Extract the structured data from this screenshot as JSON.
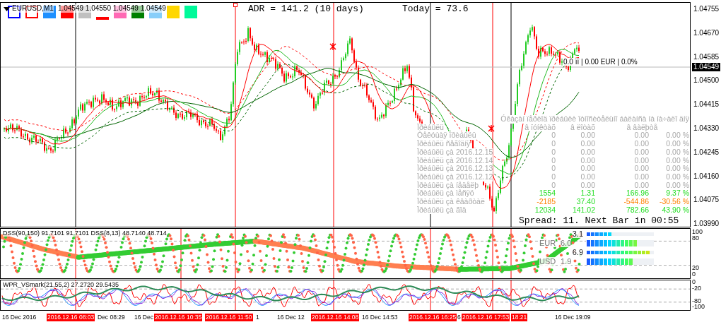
{
  "chart": {
    "symbol": "EURUSD,M1",
    "quote": "1.04549 1.04550 1.04549 1.04549",
    "swatches": [
      {
        "kind": "outline",
        "color": "#0000ff"
      },
      {
        "kind": "outline",
        "color": "#ff0000"
      },
      {
        "kind": "fill",
        "color": "#1e90ff"
      },
      {
        "kind": "fill",
        "color": "#ff0000"
      },
      {
        "kind": "fill",
        "color": "#c0c0c0"
      },
      {
        "kind": "underline",
        "color": "#ff0000"
      },
      {
        "kind": "fill",
        "color": "#ff69b4"
      },
      {
        "kind": "fill",
        "color": "#008000"
      },
      {
        "kind": "fill",
        "color": "#87cefa"
      },
      {
        "kind": "fill",
        "color": "#ffd700"
      },
      {
        "kind": "fill",
        "color": "#00fa9a"
      }
    ],
    "adr": "ADR = 141.2  (10 days)",
    "today": "Today = 73.6",
    "position_info": "0.0 ïï | 0.00 EUR | 0.0%",
    "spread": "Spread: 11. Next Bar in 00:55",
    "price_axis": [
      "1.04755",
      "1.04670",
      "1.04585",
      "1.04500",
      "1.04415",
      "1.04330",
      "1.04245",
      "1.04160",
      "1.04075",
      "1.03990"
    ],
    "current_price": "1.04549"
  },
  "stats": {
    "title": "Óêàçàí ïåðèîä ïðèáûëè îòíîñèòåëüíî áàëàíñà íà íà÷àëî äíÿ",
    "columns": [
      "Ïðèáûëü",
      "â ïóíêòàõ",
      "â ëîòàõ",
      "â âàëþòå"
    ],
    "rows": [
      {
        "label": "Òåêóùàÿ ïðèáûëü",
        "values": [
          {
            "text": "0",
            "kind": "neutral"
          },
          {
            "text": "0.00",
            "kind": "neutral"
          },
          {
            "text": "0.00",
            "kind": "neutral"
          },
          {
            "text": "0.00 %",
            "kind": "neutral"
          }
        ]
      },
      {
        "label": "Ïðèáûëü ñåãîäíÿ",
        "values": [
          {
            "text": "0",
            "kind": "neutral"
          },
          {
            "text": "0.00",
            "kind": "neutral"
          },
          {
            "text": "0.00",
            "kind": "neutral"
          },
          {
            "text": "0.00 %",
            "kind": "neutral"
          }
        ]
      },
      {
        "label": "Ïðèáûëü çà 2016.12.15",
        "values": [
          {
            "text": "0",
            "kind": "neutral"
          },
          {
            "text": "0.00",
            "kind": "neutral"
          },
          {
            "text": "0.00",
            "kind": "neutral"
          },
          {
            "text": "0.00 %",
            "kind": "neutral"
          }
        ]
      },
      {
        "label": "Ïðèáûëü çà 2016.12.14",
        "values": [
          {
            "text": "0",
            "kind": "neutral"
          },
          {
            "text": "0.00",
            "kind": "neutral"
          },
          {
            "text": "0.00",
            "kind": "neutral"
          },
          {
            "text": "0.00 %",
            "kind": "neutral"
          }
        ]
      },
      {
        "label": "Ïðèáûëü çà 2016.12.13",
        "values": [
          {
            "text": "0",
            "kind": "neutral"
          },
          {
            "text": "0.00",
            "kind": "neutral"
          },
          {
            "text": "0.00",
            "kind": "neutral"
          },
          {
            "text": "0.00 %",
            "kind": "neutral"
          }
        ]
      },
      {
        "label": "Ïðèáûëü çà 2016.12.12",
        "values": [
          {
            "text": "0",
            "kind": "neutral"
          },
          {
            "text": "0.00",
            "kind": "neutral"
          },
          {
            "text": "0.00",
            "kind": "neutral"
          },
          {
            "text": "0.00 %",
            "kind": "neutral"
          }
        ]
      },
      {
        "label": "Ïðèáûëü çà íåäåëþ",
        "values": [
          {
            "text": "0",
            "kind": "neutral"
          },
          {
            "text": "0.00",
            "kind": "neutral"
          },
          {
            "text": "0.00",
            "kind": "neutral"
          },
          {
            "text": "0.00 %",
            "kind": "neutral"
          }
        ]
      },
      {
        "label": "Ïðèáûëü çà ìåñÿö",
        "values": [
          {
            "text": "1554",
            "kind": "profit"
          },
          {
            "text": "1.31",
            "kind": "profit"
          },
          {
            "text": "166.96",
            "kind": "profit"
          },
          {
            "text": "9.37 %",
            "kind": "profit"
          }
        ]
      },
      {
        "label": "Ïðèáûëü çà êâàðòàë",
        "values": [
          {
            "text": "-2185",
            "kind": "loss"
          },
          {
            "text": "37.40",
            "kind": "profit"
          },
          {
            "text": "-544.86",
            "kind": "loss"
          },
          {
            "text": "-30.56 %",
            "kind": "loss"
          }
        ]
      },
      {
        "label": "Ïðèáûëü çà ãîä",
        "values": [
          {
            "text": "12034",
            "kind": "profit"
          },
          {
            "text": "141.02",
            "kind": "profit"
          },
          {
            "text": "782.66",
            "kind": "profit"
          },
          {
            "text": "43.90 %",
            "kind": "profit"
          }
        ]
      }
    ]
  },
  "dss_panel": {
    "title": "DSS(90,150) 91.7101 91.7101 DSS(8,13) 48.7140 48.714",
    "scale": [
      "100",
      "80",
      "20",
      "0"
    ],
    "currencies": [
      {
        "score": "3.1",
        "name": "EUR",
        "value": "6.0",
        "short_bar": {
          "level": 0.38
        },
        "long_bar": {
          "level": 0.75
        }
      },
      {
        "score": "6.9",
        "name": "USD",
        "value": "1.9",
        "short_bar": {
          "level": 0.94
        },
        "long_bar": {
          "level": 0.69
        }
      }
    ]
  },
  "wpr_panel": {
    "title": "WPR_VSmark(21,55,2) 27.2720 29.5435",
    "scale": [
      "0",
      "-20",
      "-80",
      "-100"
    ]
  },
  "time_axis": {
    "labels": [
      "16 Dec 2016",
      "Dec 08:29",
      "16 Dec",
      "1",
      "16 Dec 12",
      "16 Dec 14:53",
      "6",
      "16 Dec 19:09"
    ],
    "markers": [
      "2016.12.16 08:03",
      "2016.12.16 10:35",
      "2016.12.16 11:50",
      "2016.12.16 14:08",
      "2016.12.16 16:25",
      "2016.12.16 17:53",
      "18:21"
    ]
  }
}
